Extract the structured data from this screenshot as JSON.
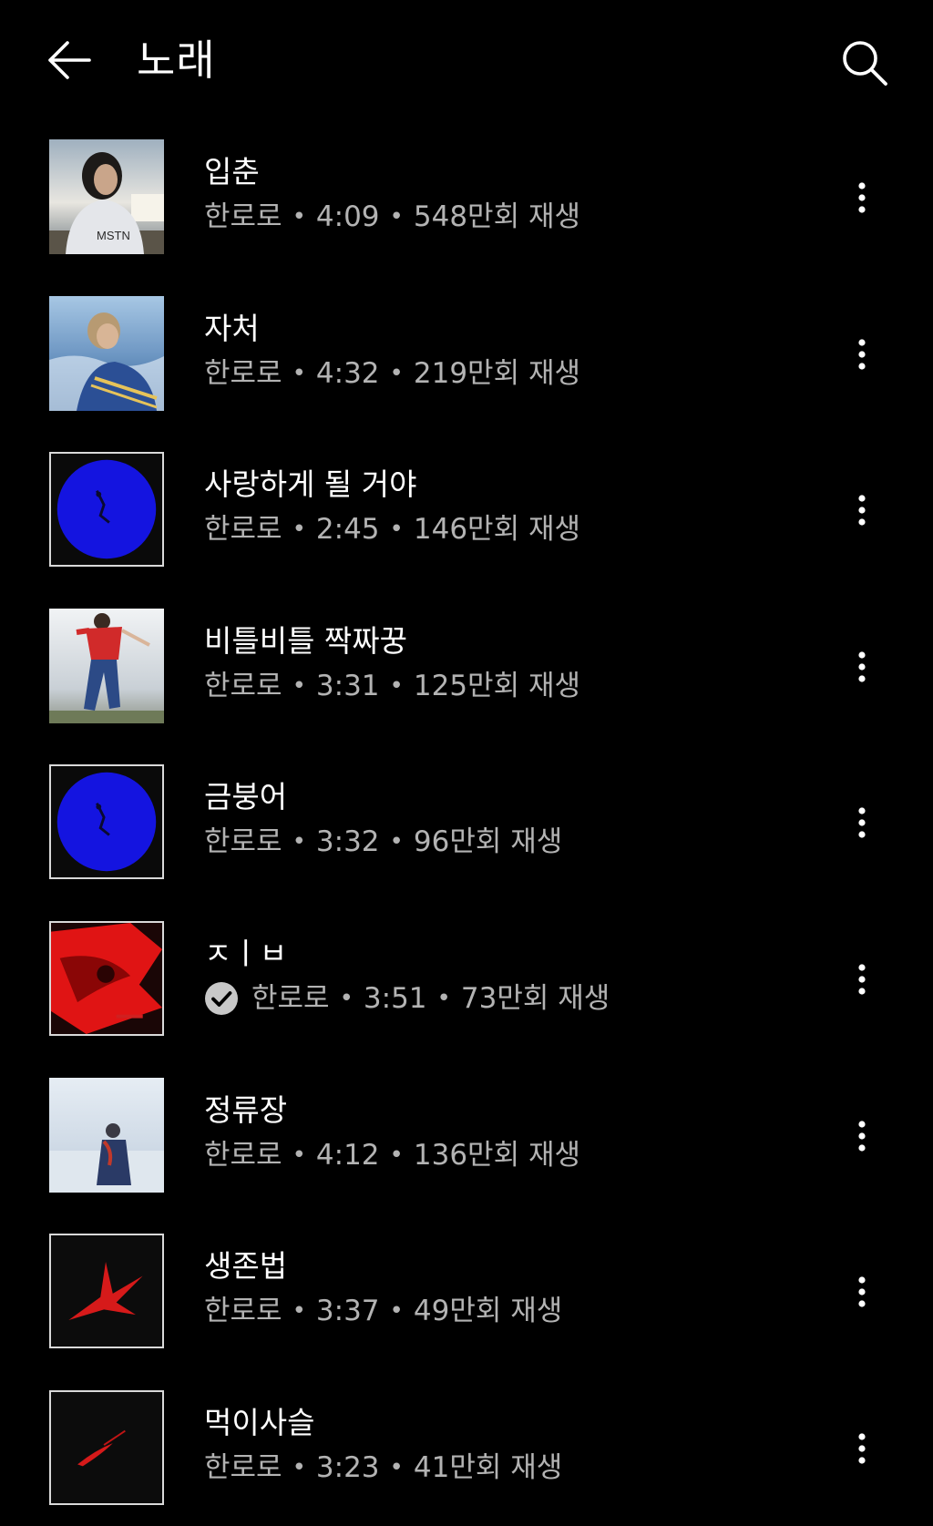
{
  "header": {
    "title": "노래",
    "back_icon": "arrow-left-icon",
    "search_icon": "search-icon"
  },
  "colors": {
    "background": "#000000",
    "title_text": "#ffffff",
    "meta_text": "#b3b3b3"
  },
  "separator": "•",
  "songs": [
    {
      "title": "입춘",
      "artist": "한로로",
      "duration": "4:09",
      "plays": "548만회 재생",
      "verified": false
    },
    {
      "title": "자처",
      "artist": "한로로",
      "duration": "4:32",
      "plays": "219만회 재생",
      "verified": false
    },
    {
      "title": "사랑하게 될 거야",
      "artist": "한로로",
      "duration": "2:45",
      "plays": "146만회 재생",
      "verified": false
    },
    {
      "title": "비틀비틀 짝짜꿍",
      "artist": "한로로",
      "duration": "3:31",
      "plays": "125만회 재생",
      "verified": false
    },
    {
      "title": "금붕어",
      "artist": "한로로",
      "duration": "3:32",
      "plays": "96만회 재생",
      "verified": false
    },
    {
      "title": "ㅈㅣㅂ",
      "artist": "한로로",
      "duration": "3:51",
      "plays": "73만회 재생",
      "verified": true
    },
    {
      "title": "정류장",
      "artist": "한로로",
      "duration": "4:12",
      "plays": "136만회 재생",
      "verified": false
    },
    {
      "title": "생존법",
      "artist": "한로로",
      "duration": "3:37",
      "plays": "49만회 재생",
      "verified": false
    },
    {
      "title": "먹이사슬",
      "artist": "한로로",
      "duration": "3:23",
      "plays": "41만회 재생",
      "verified": false
    }
  ]
}
